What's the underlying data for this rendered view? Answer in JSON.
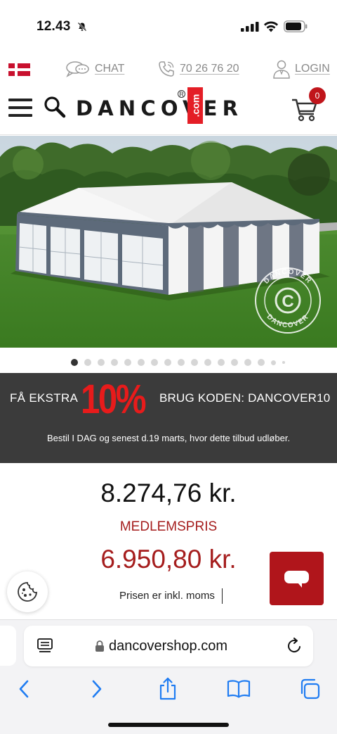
{
  "status_bar": {
    "time": "12.43"
  },
  "utility": {
    "chat_label": "CHAT",
    "phone_label": "70 26 76 20",
    "login_label": "LOGIN"
  },
  "header": {
    "logo_text": "DANCOVER",
    "logo_suffix": ".com",
    "logo_reg": "R",
    "cart_count": "0"
  },
  "carousel": {
    "total_dots": 17,
    "active_index": 0
  },
  "watermark": {
    "text": "DANCOVER"
  },
  "promo": {
    "left_text": "FÅ EKSTRA",
    "percent": "10%",
    "right_text": "BRUG KODEN: DANCOVER10",
    "note": "Bestil I DAG og senest d.19 marts, hvor dette tilbud udløber."
  },
  "pricing": {
    "price": "8.274,76 kr.",
    "member_label": "MEDLEMSPRIS",
    "member_price": "6.950,80 kr.",
    "vat_note": "Prisen er inkl. moms"
  },
  "browser": {
    "url": "dancovershop.com"
  },
  "colors": {
    "brand_red": "#e41e26",
    "price_red": "#a51d1d",
    "promo_bg": "#3b3b3b",
    "promo_percent": "#e81b1b",
    "chat_fab": "#b0151b",
    "ios_blue": "#1f7cf2"
  }
}
